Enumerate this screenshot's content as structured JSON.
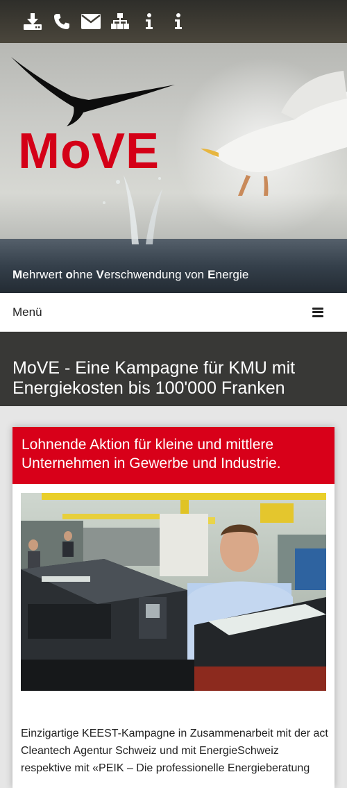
{
  "topbar": {
    "icons": [
      "download-icon",
      "phone-icon",
      "envelope-icon",
      "sitemap-icon",
      "info-icon",
      "info-icon"
    ]
  },
  "hero": {
    "logo_text": "MoVE",
    "tagline": {
      "w1_first": "M",
      "w1_rest": "ehrwert ",
      "w2_first": "o",
      "w2_rest": "hne ",
      "w3_first": "V",
      "w3_rest": "erschwendung von ",
      "w4_first": "E",
      "w4_rest": "nergie"
    },
    "logo_color": "#d40017"
  },
  "menu": {
    "label": "Menü"
  },
  "page": {
    "title": "MoVE - Eine Kampagne für KMU mit Energiekosten bis 100'000 Franken"
  },
  "card": {
    "heading": "Lohnende Aktion für kleine und mittlere Unternehmen in Gewerbe und Industrie.",
    "heading_bg": "#d80019",
    "body": "Einzigartige KEEST-Kampagne in Zusammenarbeit mit der act Cleantech Agentur Schweiz und mit EnergieSchweiz respektive mit «PEIK – Die professionelle Energieberatung"
  }
}
